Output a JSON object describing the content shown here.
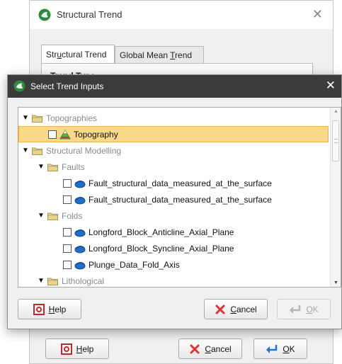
{
  "colors": {
    "selection": "#fbd88a",
    "fg_titlebar": "#3b3b3b",
    "surface_blue": "#1f6fc5",
    "folder_yellow": "#e8d48a"
  },
  "background_dialog": {
    "title": "Structural Trend",
    "tabs": [
      {
        "label_pre": "Str",
        "label_u": "u",
        "label_post": "ctural Trend",
        "active": true
      },
      {
        "label_pre": "Global Mean ",
        "label_u": "T",
        "label_post": "rend",
        "active": false
      }
    ],
    "panel_text": "Trend Type",
    "buttons": {
      "help": {
        "pre": "",
        "u": "H",
        "post": "elp"
      },
      "cancel": {
        "pre": "",
        "u": "C",
        "post": "ancel"
      },
      "ok": {
        "pre": "",
        "u": "O",
        "post": "K"
      }
    }
  },
  "dialog": {
    "title": "Select Trend Inputs",
    "tree": [
      {
        "indent": 0,
        "toggle": "▼",
        "type": "folder",
        "label": "Topographies",
        "style": "grey"
      },
      {
        "indent": 1,
        "type": "item",
        "icon": "topography-icon",
        "checkbox": true,
        "label": "Topography",
        "style": "dark",
        "selected": true
      },
      {
        "indent": 0,
        "toggle": "▼",
        "type": "folder",
        "label": "Structural Modelling",
        "style": "grey"
      },
      {
        "indent": 1,
        "toggle": "▼",
        "type": "folder",
        "label": "Faults",
        "style": "grey"
      },
      {
        "indent": 2,
        "type": "item",
        "icon": "surface-icon",
        "checkbox": true,
        "label": "Fault_structural_data_measured_at_the_surface",
        "style": "dark"
      },
      {
        "indent": 2,
        "type": "item",
        "icon": "surface-icon",
        "checkbox": true,
        "label": "Fault_structural_data_measured_at_the_surface",
        "style": "dark"
      },
      {
        "indent": 1,
        "toggle": "▼",
        "type": "folder",
        "label": "Folds",
        "style": "grey"
      },
      {
        "indent": 2,
        "type": "item",
        "icon": "surface-icon",
        "checkbox": true,
        "label": "Longford_Block_Anticline_Axial_Plane",
        "style": "dark"
      },
      {
        "indent": 2,
        "type": "item",
        "icon": "surface-icon",
        "checkbox": true,
        "label": "Longford_Block_Syncline_Axial_Plane",
        "style": "dark"
      },
      {
        "indent": 2,
        "type": "item",
        "icon": "surface-icon",
        "checkbox": true,
        "label": "Plunge_Data_Fold_Axis",
        "style": "dark"
      },
      {
        "indent": 1,
        "toggle": "▼",
        "type": "folder",
        "label": "Lithological",
        "style": "grey"
      }
    ],
    "buttons": {
      "help": {
        "pre": "",
        "u": "H",
        "post": "elp"
      },
      "cancel": {
        "pre": "",
        "u": "C",
        "post": "ancel"
      },
      "ok": {
        "pre": "",
        "u": "O",
        "post": "K"
      }
    }
  }
}
